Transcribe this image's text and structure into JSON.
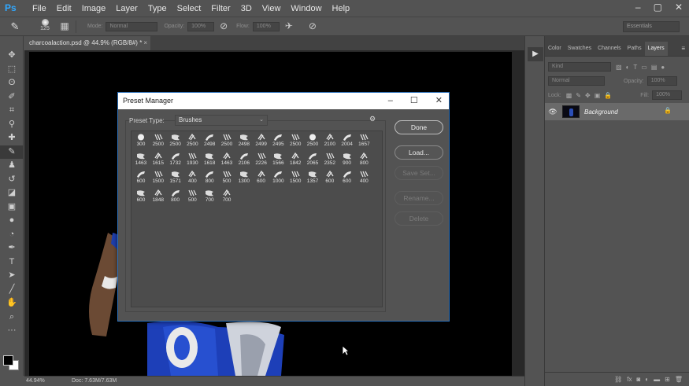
{
  "app": {
    "logo": "Ps",
    "menu": [
      "File",
      "Edit",
      "Image",
      "Layer",
      "Type",
      "Select",
      "Filter",
      "3D",
      "View",
      "Window",
      "Help"
    ],
    "window_controls": [
      "–",
      "▢",
      "✕"
    ]
  },
  "options_bar": {
    "brush_size": "125",
    "mode_label": "Mode:",
    "mode_value": "Normal",
    "opacity_label": "Opacity:",
    "opacity_value": "100%",
    "flow_label": "Flow:",
    "flow_value": "100%",
    "workspace": "Essentials"
  },
  "document": {
    "tab_title": "charcoalaction.psd @ 44.9% (RGB/8#) *",
    "close": "×",
    "zoom": "44.94%",
    "doc_size": "Doc: 7.63M/7.63M"
  },
  "layers_panel": {
    "tabs": [
      "Color",
      "Swatches",
      "Channels",
      "Paths",
      "Layers"
    ],
    "active_tab": "Layers",
    "filter_kind": "Kind",
    "blend_mode": "Normal",
    "opacity_label": "Opacity:",
    "opacity_value": "100%",
    "lock_label": "Lock:",
    "fill_label": "Fill:",
    "fill_value": "100%",
    "layer_name": "Background"
  },
  "dialog": {
    "title": "Preset Manager",
    "preset_type_label": "Preset Type:",
    "preset_type_value": "Brushes",
    "buttons": {
      "done": "Done",
      "load": "Load...",
      "save_set": "Save Set...",
      "rename": "Rename...",
      "delete": "Delete"
    },
    "brush_sizes": [
      "300",
      "2500",
      "2500",
      "2500",
      "2498",
      "2500",
      "2498",
      "2499",
      "2495",
      "2500",
      "2500",
      "2100",
      "2004",
      "1657",
      "1463",
      "1615",
      "1732",
      "1930",
      "1618",
      "1463",
      "2106",
      "2226",
      "1566",
      "1842",
      "2065",
      "2352",
      "900",
      "800",
      "600",
      "1500",
      "1571",
      "400",
      "800",
      "500",
      "1300",
      "600",
      "1000",
      "1500",
      "1357",
      "600",
      "600",
      "400",
      "600",
      "1848",
      "800",
      "500",
      "700",
      "700"
    ]
  }
}
